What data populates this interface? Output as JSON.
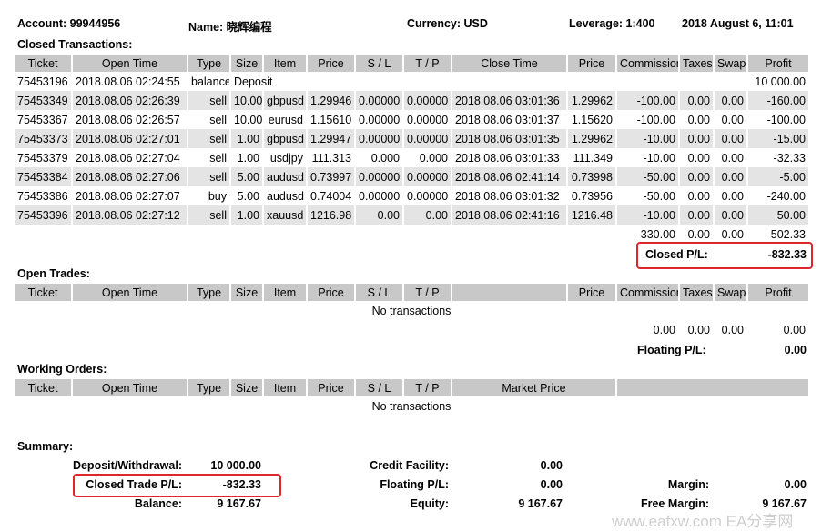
{
  "header": {
    "account": "Account: 99944956",
    "name": "Name: 晓辉编程",
    "currency": "Currency: USD",
    "leverage": "Leverage: 1:400",
    "datetime": "2018 August 6, 11:01"
  },
  "closed": {
    "title": "Closed Transactions:",
    "columns": [
      "Ticket",
      "Open Time",
      "Type",
      "Size",
      "Item",
      "Price",
      "S / L",
      "T / P",
      "Close Time",
      "Price",
      "Commission",
      "Taxes",
      "Swap",
      "Profit"
    ],
    "deposit_row": [
      "75453196",
      "2018.08.06 02:24:55",
      "balance",
      "Deposit",
      "10 000.00"
    ],
    "rows": [
      [
        "75453349",
        "2018.08.06 02:26:39",
        "sell",
        "10.00",
        "gbpusd",
        "1.29946",
        "0.00000",
        "0.00000",
        "2018.08.06 03:01:36",
        "1.29962",
        "-100.00",
        "0.00",
        "0.00",
        "-160.00"
      ],
      [
        "75453367",
        "2018.08.06 02:26:57",
        "sell",
        "10.00",
        "eurusd",
        "1.15610",
        "0.00000",
        "0.00000",
        "2018.08.06 03:01:37",
        "1.15620",
        "-100.00",
        "0.00",
        "0.00",
        "-100.00"
      ],
      [
        "75453373",
        "2018.08.06 02:27:01",
        "sell",
        "1.00",
        "gbpusd",
        "1.29947",
        "0.00000",
        "0.00000",
        "2018.08.06 03:01:35",
        "1.29962",
        "-10.00",
        "0.00",
        "0.00",
        "-15.00"
      ],
      [
        "75453379",
        "2018.08.06 02:27:04",
        "sell",
        "1.00",
        "usdjpy",
        "111.313",
        "0.000",
        "0.000",
        "2018.08.06 03:01:33",
        "111.349",
        "-10.00",
        "0.00",
        "0.00",
        "-32.33"
      ],
      [
        "75453384",
        "2018.08.06 02:27:06",
        "sell",
        "5.00",
        "audusd",
        "0.73997",
        "0.00000",
        "0.00000",
        "2018.08.06 02:41:14",
        "0.73998",
        "-50.00",
        "0.00",
        "0.00",
        "-5.00"
      ],
      [
        "75453386",
        "2018.08.06 02:27:07",
        "buy",
        "5.00",
        "audusd",
        "0.74004",
        "0.00000",
        "0.00000",
        "2018.08.06 03:01:32",
        "0.73956",
        "-50.00",
        "0.00",
        "0.00",
        "-240.00"
      ],
      [
        "75453396",
        "2018.08.06 02:27:12",
        "sell",
        "1.00",
        "xauusd",
        "1216.98",
        "0.00",
        "0.00",
        "2018.08.06 02:41:16",
        "1216.48",
        "-10.00",
        "0.00",
        "0.00",
        "50.00"
      ]
    ],
    "totals": [
      "-330.00",
      "0.00",
      "0.00",
      "-502.33"
    ],
    "pl_label": "Closed P/L:",
    "pl_value": "-832.33"
  },
  "open_trades": {
    "title": "Open Trades:",
    "columns": [
      "Ticket",
      "Open Time",
      "Type",
      "Size",
      "Item",
      "Price",
      "S / L",
      "T / P",
      "",
      "Price",
      "Commission",
      "Taxes",
      "Swap",
      "Profit"
    ],
    "empty": "No transactions",
    "totals": [
      "0.00",
      "0.00",
      "0.00",
      "0.00"
    ],
    "pl_label": "Floating P/L:",
    "pl_value": "0.00"
  },
  "working_orders": {
    "title": "Working Orders:",
    "columns": [
      "Ticket",
      "Open Time",
      "Type",
      "Size",
      "Item",
      "Price",
      "S / L",
      "T / P",
      "Market Price"
    ],
    "empty": "No transactions"
  },
  "summary": {
    "title": "Summary:",
    "deposit_label": "Deposit/Withdrawal:",
    "deposit_value": "10 000.00",
    "closed_label": "Closed Trade P/L:",
    "closed_value": "-832.33",
    "balance_label": "Balance:",
    "balance_value": "9 167.67",
    "credit_label": "Credit Facility:",
    "credit_value": "0.00",
    "floating_label": "Floating P/L:",
    "floating_value": "0.00",
    "equity_label": "Equity:",
    "equity_value": "9 167.67",
    "margin_label": "Margin:",
    "margin_value": "0.00",
    "free_margin_label": "Free Margin:",
    "free_margin_value": "9 167.67"
  },
  "watermark": "www.eafxw.com  EA分享网",
  "colors": {
    "header_bg": "#c8c8c8",
    "row_alt": "#e4e4e4",
    "highlight": "#e0262b"
  }
}
